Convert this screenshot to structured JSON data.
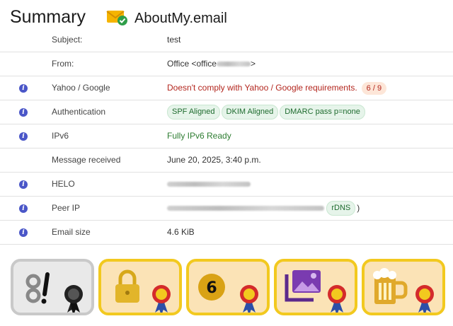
{
  "header": {
    "title": "Summary",
    "brand_name": "AboutMy.email"
  },
  "rows": [
    {
      "label": "Subject:",
      "value": "test"
    },
    {
      "label": "From:",
      "value": "Office <office"
    },
    {
      "label": "Yahoo / Google",
      "value": "Doesn't comply with Yahoo / Google requirements.",
      "badge": "6 / 9"
    },
    {
      "label": "Authentication",
      "pills": [
        "SPF Aligned",
        "DKIM Aligned",
        "DMARC pass p=none"
      ]
    },
    {
      "label": "IPv6",
      "value": "Fully IPv6 Ready"
    },
    {
      "label": "Message received",
      "value": "June 20, 2025, 3:40 p.m."
    },
    {
      "label": "HELO",
      "value": ""
    },
    {
      "label": "Peer IP",
      "pill": "rDNS",
      "suffix": ")"
    },
    {
      "label": "Email size",
      "value": "4.6 KiB"
    }
  ],
  "badge_icons": [
    "code-score-icon",
    "lock-icon",
    "grade-six-icon",
    "image-icon",
    "beer-icon"
  ],
  "colors": {
    "info": "#4a56c8",
    "error": "#b3261e",
    "ok": "#2e7d32",
    "badge_gold": "#f2c91f",
    "badge_bg": "#fbe3b6"
  }
}
